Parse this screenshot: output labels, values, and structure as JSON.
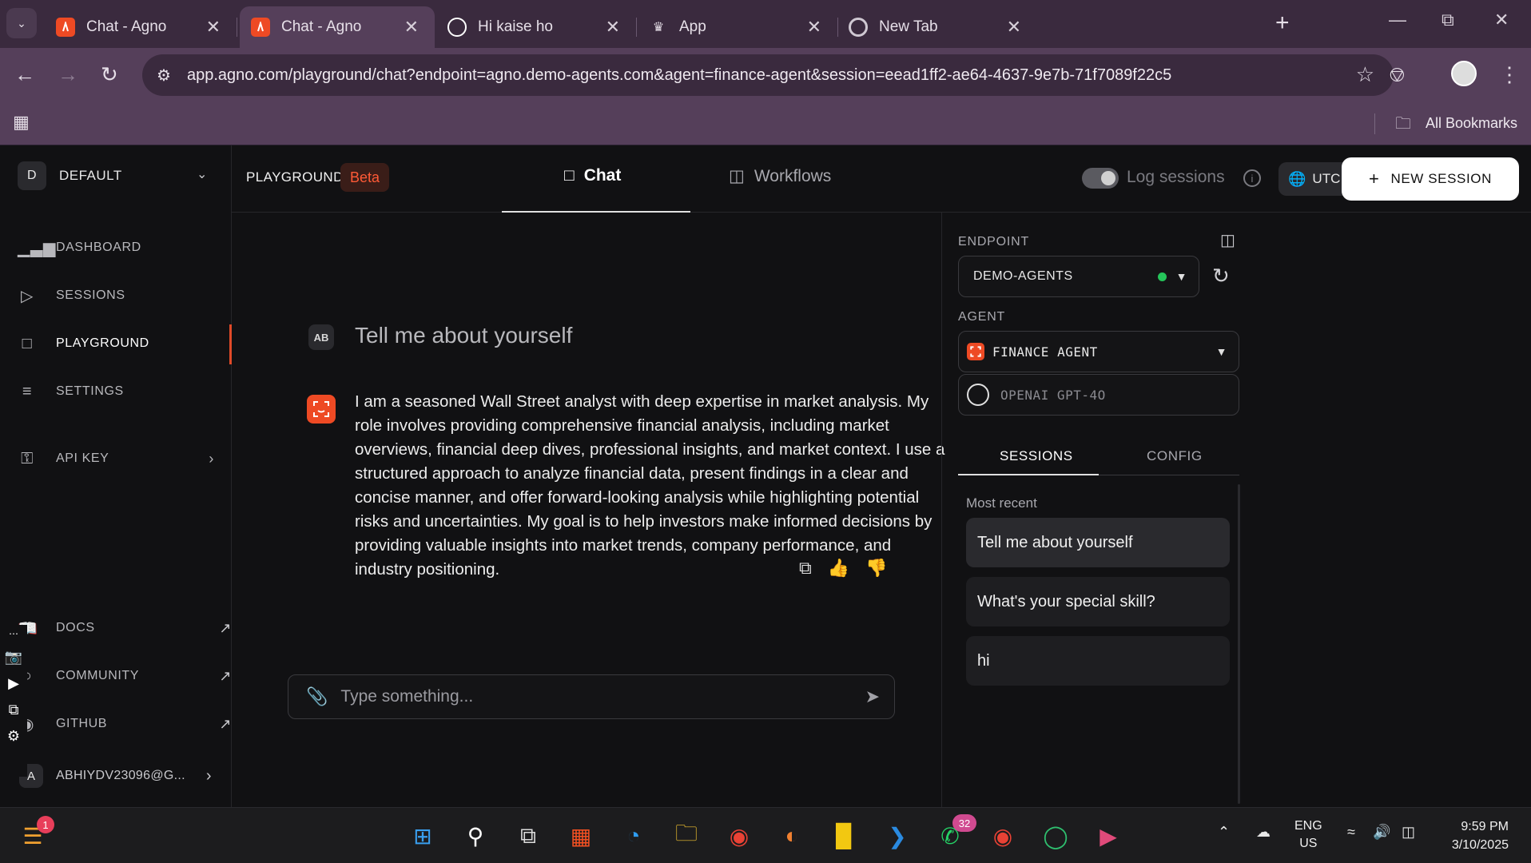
{
  "browser": {
    "tabs": [
      {
        "title": "Chat - Agno",
        "active": false
      },
      {
        "title": "Chat - Agno",
        "active": true
      },
      {
        "title": "Hi kaise ho",
        "active": false
      },
      {
        "title": "App",
        "active": false
      },
      {
        "title": "New Tab",
        "active": false
      }
    ],
    "url": "app.agno.com/playground/chat?endpoint=agno.demo-agents.com&agent=finance-agent&session=eead1ff2-ae64-4637-9e7b-71f7089f22c5",
    "bookmarks_label": "All Bookmarks"
  },
  "sidebar": {
    "workspace_initial": "D",
    "workspace_name": "DEFAULT",
    "nav": [
      {
        "label": "DASHBOARD",
        "icon": "bar-chart-icon"
      },
      {
        "label": "SESSIONS",
        "icon": "play-icon"
      },
      {
        "label": "PLAYGROUND",
        "icon": "chat-icon",
        "active": true
      },
      {
        "label": "SETTINGS",
        "icon": "sliders-icon"
      },
      {
        "label": "API KEY",
        "icon": "key-icon"
      }
    ],
    "links": [
      {
        "label": "DOCS",
        "icon": "book-icon"
      },
      {
        "label": "COMMUNITY",
        "icon": "community-icon"
      },
      {
        "label": "GITHUB",
        "icon": "github-icon"
      }
    ],
    "user_initial": "A",
    "user_email": "ABHIYDV23096@G..."
  },
  "header": {
    "playground_label": "PLAYGROUND",
    "beta_label": "Beta",
    "tabs": [
      {
        "label": "Chat",
        "active": true
      },
      {
        "label": "Workflows",
        "active": false
      }
    ],
    "log_sessions_label": "Log sessions",
    "timezone": "UTC",
    "new_session_label": "NEW SESSION"
  },
  "chat": {
    "user_initials": "AB",
    "user_message": "Tell me about yourself",
    "agent_message": "I am a seasoned Wall Street analyst with deep expertise in market analysis. My role involves providing comprehensive financial analysis, including market overviews, financial deep dives, professional insights, and market context. I use a structured approach to analyze financial data, present findings in a clear and concise manner, and offer forward-looking analysis while highlighting potential risks and uncertainties. My goal is to help investors make informed decisions by providing valuable insights into market trends, company performance, and industry positioning.",
    "composer_placeholder": "Type something..."
  },
  "panel": {
    "endpoint_label": "ENDPOINT",
    "endpoint_value": "DEMO-AGENTS",
    "endpoint_status_color": "#25c45a",
    "agent_label": "AGENT",
    "agent_value": "FINANCE AGENT",
    "model_value": "OPENAI GPT-4O",
    "tabs": [
      {
        "label": "SESSIONS",
        "active": true
      },
      {
        "label": "CONFIG",
        "active": false
      }
    ],
    "most_recent_label": "Most recent",
    "sessions": [
      {
        "title": "Tell me about yourself",
        "selected": true
      },
      {
        "title": "What's your special skill?",
        "selected": false
      },
      {
        "title": "hi",
        "selected": false
      }
    ]
  },
  "taskbar": {
    "start_badge": "1",
    "whatsapp_badge": "32",
    "language": "ENG",
    "region": "US",
    "time": "9:59 PM",
    "date": "3/10/2025"
  },
  "colors": {
    "accent": "#ee4a24",
    "chrome": "#553f5a",
    "background": "#111113"
  }
}
